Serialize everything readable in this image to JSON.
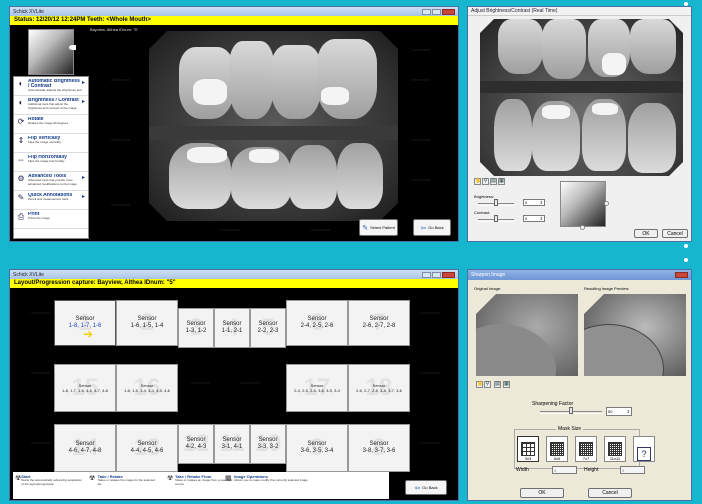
{
  "w1": {
    "title": "Schick XVLite",
    "info_bar": "Status: 12/20/12 12:24PM  Teeth: <Whole Mouth>",
    "patient_line": "Bayview, Althea   IDnum: \"5\"",
    "watermark": "Unlicensed",
    "menu": [
      {
        "title": "Automatic Brightness / Contrast",
        "desc": "Automatically adjusts the brightness and contrast of the image.",
        "icon": "auto-adjust-icon"
      },
      {
        "title": "Brightness / Contrast",
        "desc": "Additional tools that adjust the brightness and contrast of the image",
        "icon": "brightness-icon"
      },
      {
        "title": "Rotate",
        "desc": "Rotates the image 90 degrees",
        "icon": "rotate-icon"
      },
      {
        "title": "Flip Vertically",
        "desc": "Flips the image vertically",
        "icon": "flip-vertical-icon"
      },
      {
        "title": "Flip Horizontally",
        "desc": "Flips the image horizontally",
        "icon": "flip-horizontal-icon"
      },
      {
        "title": "Advanced Tools",
        "desc": "Advanced tools that provide more advanced modifications to the image",
        "icon": "advanced-tools-icon"
      },
      {
        "title": "Quick Annotations",
        "desc": "Pencil and measurement tools",
        "icon": "annotation-icon"
      },
      {
        "title": "Print",
        "desc": "Prints the image",
        "icon": "print-icon"
      }
    ],
    "select_patient": "Select Patient",
    "go_back": "Go Back"
  },
  "w2": {
    "title": "Adjust Brightness/Contrast (Real Time)",
    "brightness_label": "Brightness:",
    "brightness_value": "0",
    "contrast_label": "Contrast:",
    "contrast_value": "0",
    "brightness_level": 0.5,
    "contrast_level": 0.5,
    "ok": "OK",
    "cancel": "Cancel"
  },
  "w3": {
    "title": "Schick XVLite",
    "info_bar": "Layout/Progression capture: Bayview, Althea   IDnum: \"5\"",
    "sensors": [
      {
        "label": "Sensor",
        "value": "1-8, 1-7, 1-6",
        "big": "1",
        "selected": true
      },
      {
        "label": "Sensor",
        "value": "1-6, 1-5, 1-4",
        "big": "2"
      },
      {
        "label": "Sensor",
        "value": "1-3, 1-2",
        "big": "3"
      },
      {
        "label": "Sensor",
        "value": "1-1, 2-1",
        "big": "4"
      },
      {
        "label": "Sensor",
        "value": "2-2, 2-3",
        "big": "5"
      },
      {
        "label": "Sensor",
        "value": "2-4, 2-5, 2-6",
        "big": "6"
      },
      {
        "label": "Sensor",
        "value": "2-6, 2-7, 2-8",
        "big": "7"
      },
      {
        "label": "Sensor",
        "value": "1-8, 1-7, 1-6, 4-6, 4-7, 4-8",
        "big": "15"
      },
      {
        "label": "Sensor",
        "value": "1-6, 1-5, 1-4, 4-4, 4-5, 4-6",
        "big": "16"
      },
      {
        "label": "Sensor",
        "value": "2-4, 2-5, 2-6, 3-6, 3-5, 3-4",
        "big": "17"
      },
      {
        "label": "Sensor",
        "value": "2-6, 2-7, 2-8, 3-8, 3-7, 3-6",
        "big": "18"
      },
      {
        "label": "Sensor",
        "value": "4-6, 4-7, 4-8",
        "big": "14"
      },
      {
        "label": "Sensor",
        "value": "4-4, 4-5, 4-6",
        "big": "13"
      },
      {
        "label": "Sensor",
        "value": "4-2, 4-3",
        "big": "12"
      },
      {
        "label": "Sensor",
        "value": "3-1, 4-1",
        "big": "11"
      },
      {
        "label": "Sensor",
        "value": "3-3, 3-2",
        "big": "10"
      },
      {
        "label": "Sensor",
        "value": "3-6, 3-5, 3-4",
        "big": "9"
      },
      {
        "label": "Sensor",
        "value": "3-8, 3-7, 3-6",
        "big": "8"
      }
    ],
    "bottom": [
      {
        "title": "Start",
        "desc": "Starts the automatically advancing acquisition of the layout/progression",
        "icon": "start-icon"
      },
      {
        "title": "Take / Retake",
        "desc": "Takes or retakes the image for the selected tile",
        "icon": "take-icon"
      },
      {
        "title": "Take / Retake From",
        "desc": "Takes or retakes an image from a specified source",
        "icon": "take-from-icon"
      },
      {
        "title": "Image Operations",
        "desc": "Allows you to make modify the currently selected image",
        "icon": "image-ops-icon"
      }
    ],
    "go_back": "Go Back"
  },
  "w4": {
    "title": "Sharpen Image",
    "original_label": "Original Image:",
    "result_label": "Resulting Image Preview:",
    "sharpening_label": "Sharpening Factor",
    "sharpening_value": "50",
    "sharpening_level": 0.5,
    "mask_label": "Mask Size",
    "masks": [
      "3x3",
      "5x5",
      "7x7",
      "11x11",
      "?"
    ],
    "width_label": "Width",
    "width_value": "3",
    "height_label": "Height",
    "height_value": "3",
    "ok": "OK",
    "cancel": "Cancel"
  }
}
